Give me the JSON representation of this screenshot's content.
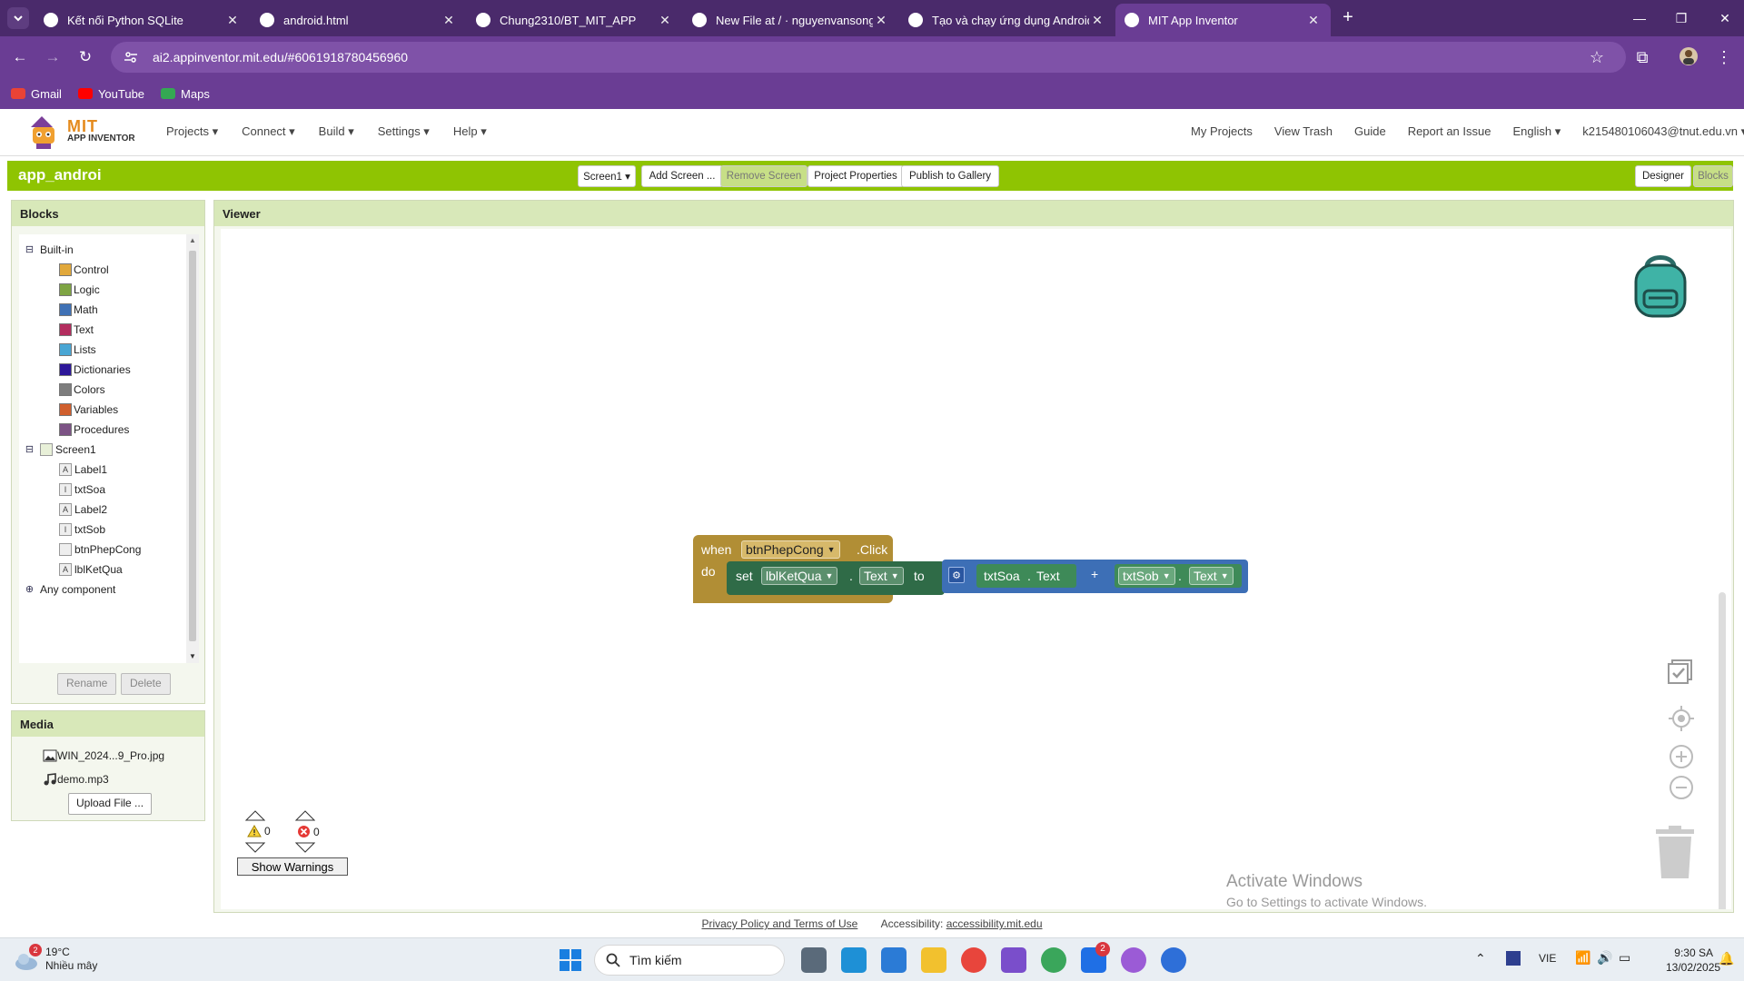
{
  "browser": {
    "tabs": [
      {
        "title": "Kết nối Python SQLite",
        "icon": "chrome-icon",
        "active": false
      },
      {
        "title": "android.html",
        "icon": "globe-icon",
        "active": false
      },
      {
        "title": "Chung2310/BT_MIT_APP",
        "icon": "github-icon",
        "active": false
      },
      {
        "title": "New File at / · nguyenvansong-",
        "icon": "github-icon",
        "active": false
      },
      {
        "title": "Tạo và chạy ứng dụng Android",
        "icon": "android-icon",
        "active": false
      },
      {
        "title": "MIT App Inventor",
        "icon": "appinventor-icon",
        "active": true
      }
    ],
    "url": "ai2.appinventor.mit.edu/#6061918780456960",
    "bookmarks": [
      {
        "label": "Gmail",
        "color": "#ea4335"
      },
      {
        "label": "YouTube",
        "color": "#ff0000"
      },
      {
        "label": "Maps",
        "color": "#34a853"
      }
    ]
  },
  "app": {
    "logo_mit": "MIT",
    "logo_sub": "APP INVENTOR",
    "menu_left": [
      "Projects ▾",
      "Connect ▾",
      "Build ▾",
      "Settings ▾",
      "Help ▾"
    ],
    "menu_right": [
      "My Projects",
      "View Trash",
      "Guide",
      "Report an Issue",
      "English ▾",
      "k215480106043@tnut.edu.vn ▾"
    ],
    "project_name": "app_androi",
    "toolbar": {
      "screen": "Screen1 ▾",
      "add_screen": "Add Screen ...",
      "remove_screen": "Remove Screen",
      "project_properties": "Project Properties",
      "publish": "Publish to Gallery",
      "designer": "Designer",
      "blocks": "Blocks"
    },
    "accent_color": "#8fc402"
  },
  "blocks_panel": {
    "title": "Blocks",
    "builtin_label": "Built-in",
    "builtin": [
      {
        "label": "Control",
        "color": "#e1a83b"
      },
      {
        "label": "Logic",
        "color": "#7ea443"
      },
      {
        "label": "Math",
        "color": "#3f71b5"
      },
      {
        "label": "Text",
        "color": "#b32d5e"
      },
      {
        "label": "Lists",
        "color": "#49a6d4"
      },
      {
        "label": "Dictionaries",
        "color": "#2d1799"
      },
      {
        "label": "Colors",
        "color": "#7d7d7d"
      },
      {
        "label": "Variables",
        "color": "#d05f2d"
      },
      {
        "label": "Procedures",
        "color": "#7c5385"
      }
    ],
    "screen_label": "Screen1",
    "components": [
      {
        "label": "Label1",
        "icon": "label-icon"
      },
      {
        "label": "txtSoa",
        "icon": "textbox-icon"
      },
      {
        "label": "Label2",
        "icon": "label-icon"
      },
      {
        "label": "txtSob",
        "icon": "textbox-icon"
      },
      {
        "label": "btnPhepCong",
        "icon": "button-icon"
      },
      {
        "label": "lblKetQua",
        "icon": "label-icon"
      }
    ],
    "any_component": "Any component",
    "rename": "Rename",
    "delete": "Delete"
  },
  "media_panel": {
    "title": "Media",
    "files": [
      "WIN_2024...9_Pro.jpg",
      "demo.mp3"
    ],
    "upload": "Upload File ..."
  },
  "viewer": {
    "title": "Viewer",
    "event_block": {
      "when": "when",
      "component": "btnPhepCong",
      "event": ".Click",
      "do": "do"
    },
    "set_block": {
      "set": "set",
      "component": "lblKetQua",
      "dot": ".",
      "property": "Text",
      "to": "to"
    },
    "math_block": {
      "left_component": "txtSoa",
      "left_dot": ".",
      "left_property": "Text",
      "operator": "+",
      "right_component": "txtSob",
      "right_dot": ".",
      "right_property": "Text"
    },
    "warnings_count": "0",
    "errors_count": "0",
    "show_warnings": "Show Warnings",
    "watermark_title": "Activate Windows",
    "watermark_sub": "Go to Settings to activate Windows."
  },
  "footer": {
    "privacy": "Privacy Policy and Terms of Use",
    "accessibility_label": "Accessibility:",
    "accessibility_link": "accessibility.mit.edu"
  },
  "taskbar": {
    "weather_temp": "19°C",
    "weather_desc": "Nhiều mây",
    "weather_badge": "2",
    "search_placeholder": "Tìm kiếm",
    "lang": "VIE",
    "time": "9:30 SA",
    "date": "13/02/2025",
    "zalo_badge": "2"
  }
}
